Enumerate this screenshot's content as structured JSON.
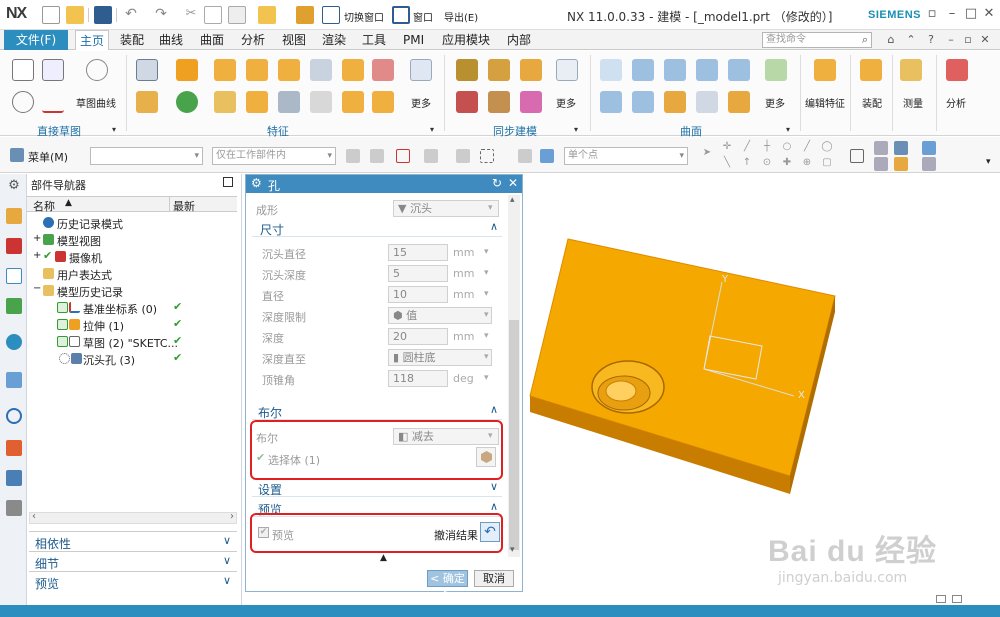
{
  "app": {
    "logo": "NX",
    "title": "NX 11.0.0.33 - 建模 - [_model1.prt （修改的）]",
    "brand": "SIEMENS",
    "switch_window": "切换窗口",
    "window_menu": "窗口",
    "export_menu": "导出(E)"
  },
  "menu": {
    "file": "文件(F)",
    "tabs": [
      "主页",
      "装配",
      "曲线",
      "曲面",
      "分析",
      "视图",
      "渲染",
      "工具",
      "PMI",
      "应用模块",
      "内部"
    ],
    "search_placeholder": "查找命令"
  },
  "ribbon": {
    "groups": [
      "直接草图",
      "特征",
      "同步建模",
      "曲面"
    ],
    "labels": {
      "sketch_curve": "草图曲线",
      "more1": "更多",
      "more2": "更多",
      "more3": "更多",
      "edit_feature": "编辑特征",
      "assembly": "装配",
      "measure": "测量",
      "analysis": "分析"
    }
  },
  "cmdbar": {
    "menu": "菜单(M)",
    "filter_scope": "仅在工作部件内",
    "snap": "单个点"
  },
  "navigator": {
    "title": "部件导航器",
    "col_name": "名称",
    "col_latest": "最新",
    "rows": [
      {
        "label": "历史记录模式",
        "check": ""
      },
      {
        "label": "模型视图",
        "check": ""
      },
      {
        "label": "摄像机",
        "check": ""
      },
      {
        "label": "用户表达式",
        "check": ""
      },
      {
        "label": "模型历史记录",
        "check": ""
      },
      {
        "label": "基准坐标系 (0)",
        "check": "✔"
      },
      {
        "label": "拉伸 (1)",
        "check": "✔"
      },
      {
        "label": "草图 (2) \"SKETC...",
        "check": "✔"
      },
      {
        "label": "沉头孔 (3)",
        "check": "✔"
      }
    ],
    "accordions": [
      "相依性",
      "细节",
      "预览"
    ]
  },
  "dialog": {
    "title": "孔",
    "form_label": "成形",
    "form_value": "沉头",
    "sections": {
      "dims": "尺寸",
      "boolean": "布尔",
      "settings": "设置",
      "preview": "预览"
    },
    "fields": [
      {
        "label": "沉头直径",
        "value": "15",
        "unit": "mm"
      },
      {
        "label": "沉头深度",
        "value": "5",
        "unit": "mm"
      },
      {
        "label": "直径",
        "value": "10",
        "unit": "mm"
      },
      {
        "label": "深度限制",
        "value": "值",
        "unit": ""
      },
      {
        "label": "深度",
        "value": "20",
        "unit": "mm"
      },
      {
        "label": "深度直至",
        "value": "圆柱底",
        "unit": ""
      },
      {
        "label": "顶锥角",
        "value": "118",
        "unit": "deg"
      }
    ],
    "boolean_label": "布尔",
    "boolean_value": "减去",
    "select_body": "选择体 (1)",
    "preview_check": "预览",
    "undo_result": "撤消结果",
    "ok": "< 确定 >",
    "cancel": "取消"
  },
  "viewport": {
    "axis_x": "X",
    "axis_y": "Y",
    "part_color": "#f5a800",
    "watermark": "Bai du 经验",
    "watermark_url": "jingyan.baidu.com"
  }
}
